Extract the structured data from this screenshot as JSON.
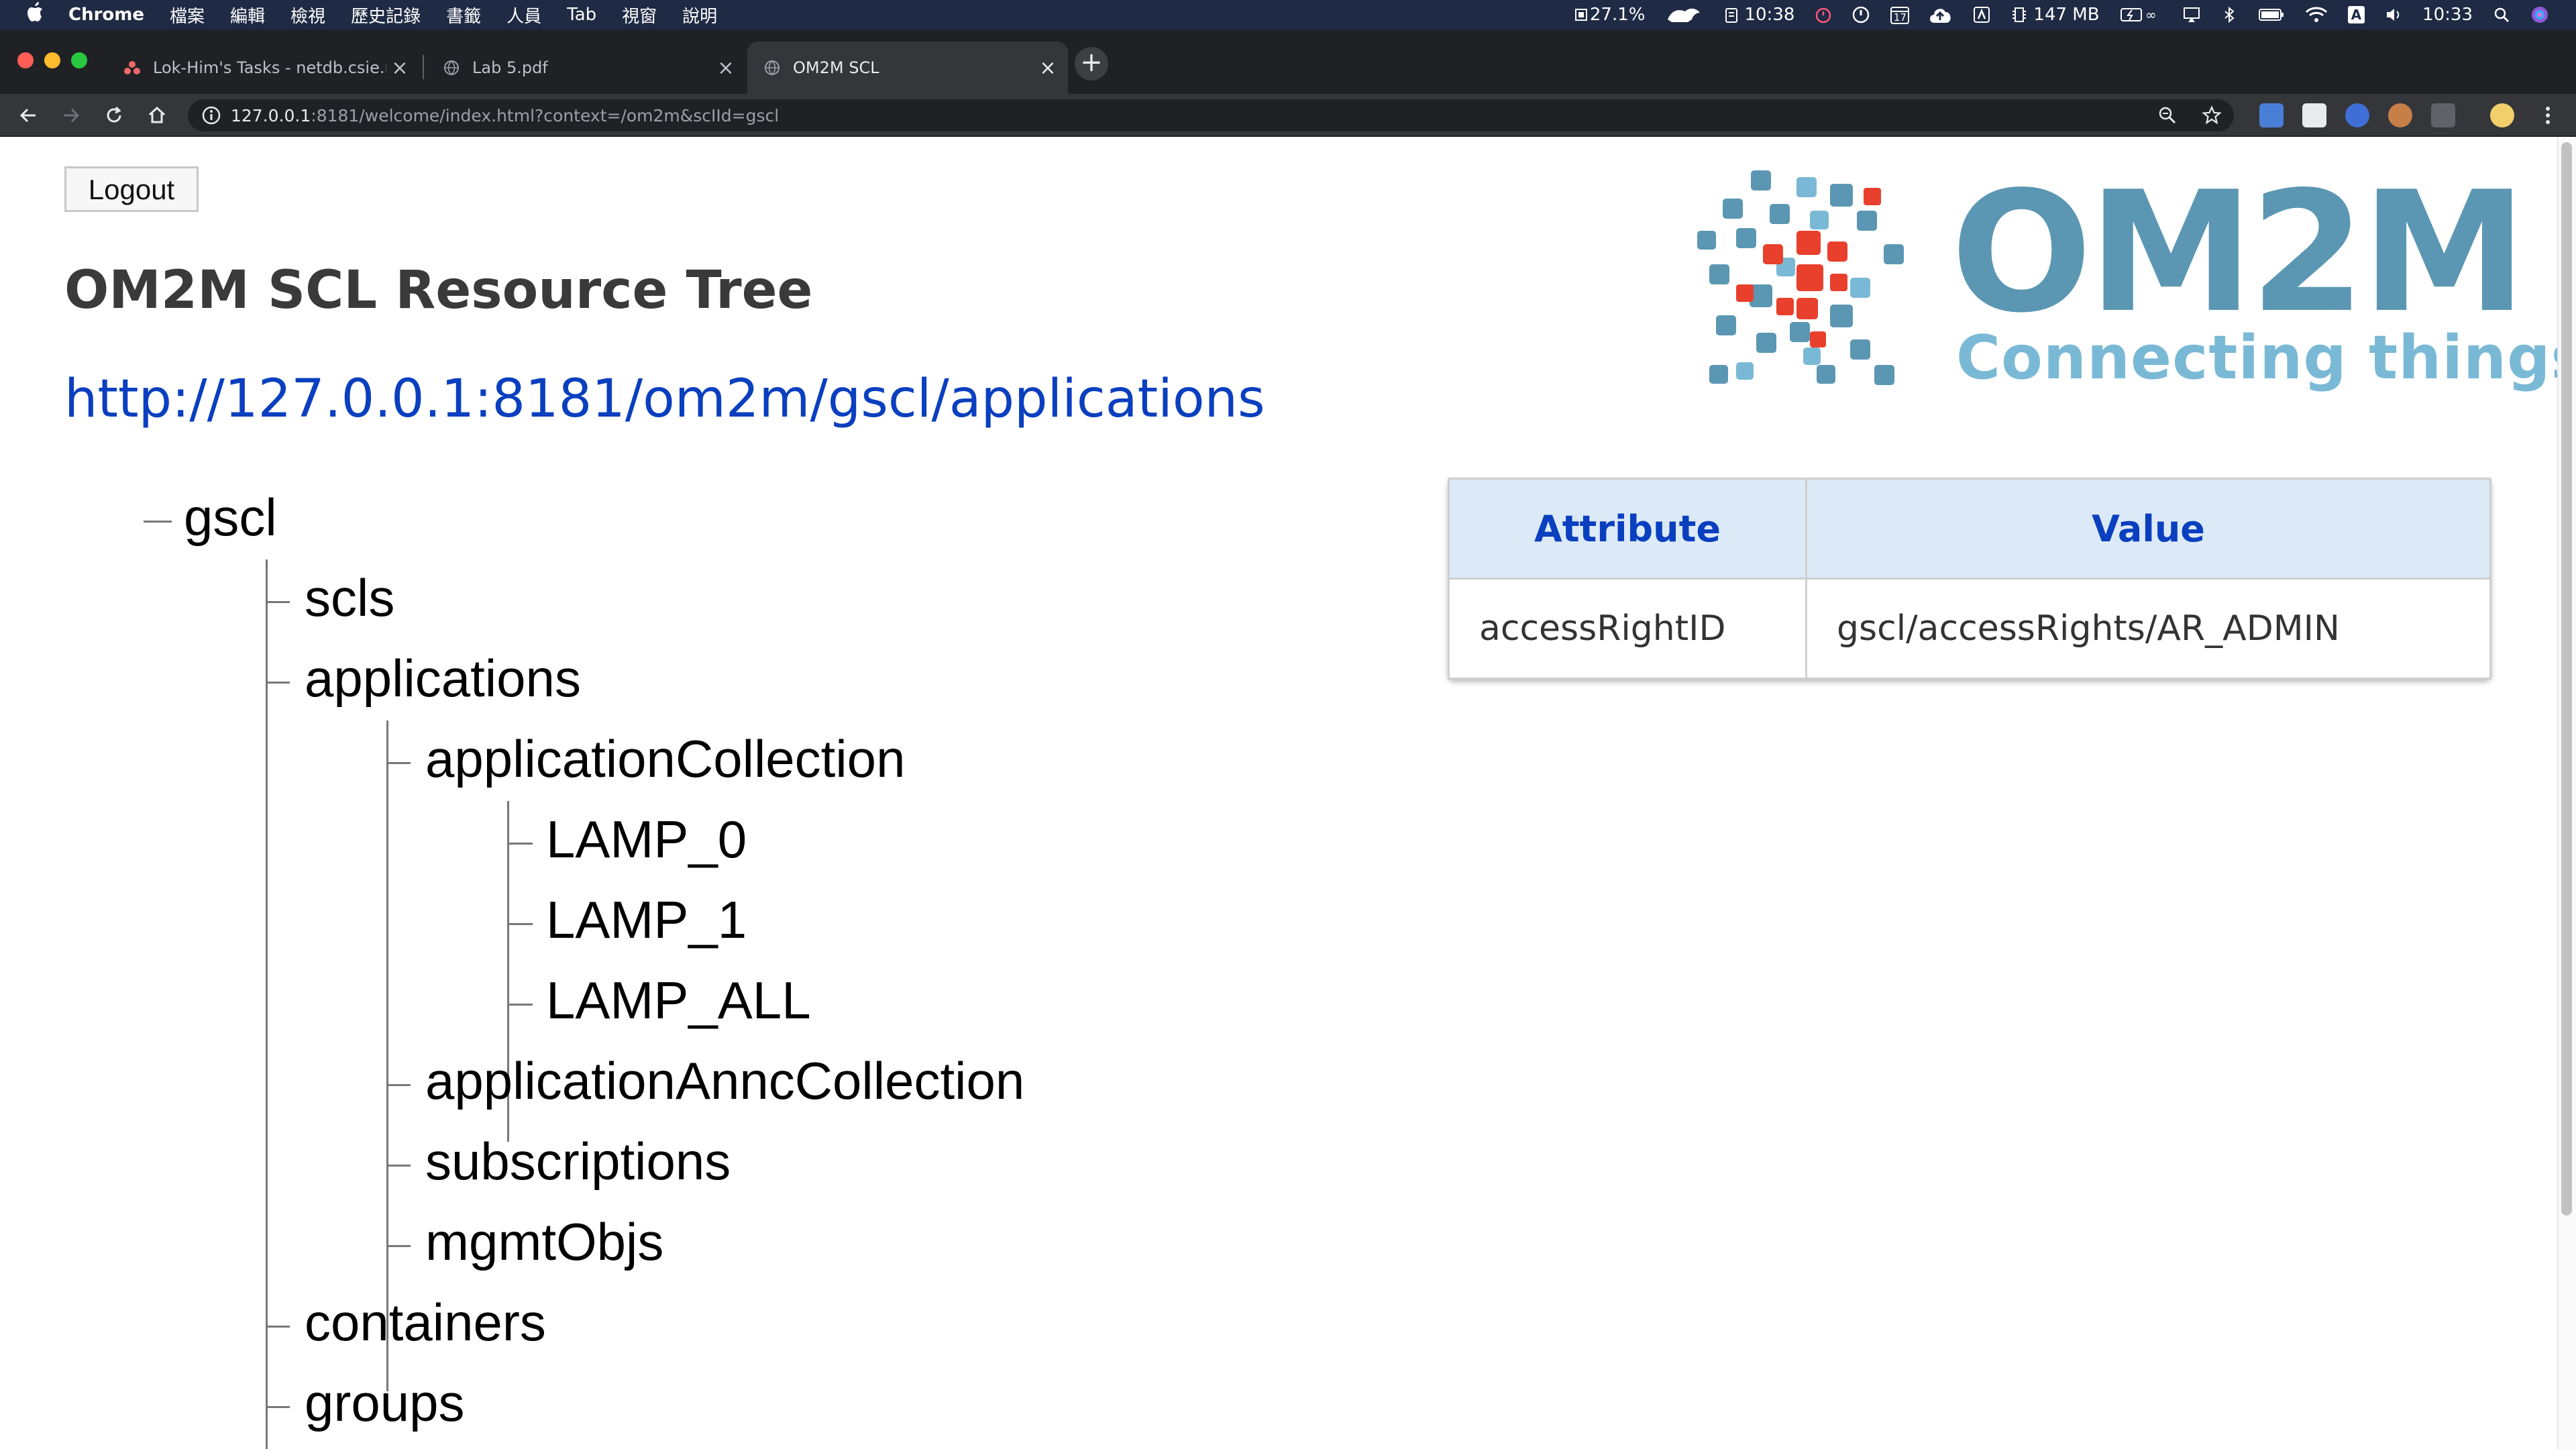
{
  "menubar": {
    "app_name": "Chrome",
    "menus": [
      "檔案",
      "編輯",
      "檢視",
      "歷史記錄",
      "書籤",
      "人員",
      "Tab",
      "視窗",
      "說明"
    ],
    "status": {
      "cpu": "27.1%",
      "time_first": "10:38",
      "calendar_day": "17",
      "memory": "147 MB",
      "input_method": "A",
      "clock": "10:33"
    }
  },
  "browser": {
    "tabs": [
      {
        "title": "Lok-Him's Tasks - netdb.csie.ncku",
        "close": "×"
      },
      {
        "title": "Lab 5.pdf",
        "close": "×"
      },
      {
        "title": "OM2M SCL",
        "close": "×"
      }
    ],
    "new_tab": "+",
    "url_host": "127.0.0.1",
    "url_rest": ":8181/welcome/index.html?context=/om2m&scIId=gscl"
  },
  "page": {
    "logout_label": "Logout",
    "title": "OM2M SCL Resource Tree",
    "resource_uri": "http://127.0.0.1:8181/om2m/gscl/applications",
    "logo": {
      "name": "OM2M",
      "tagline": "Connecting things"
    },
    "tree": {
      "root": "gscl",
      "level1": [
        "scls",
        "applications",
        "containers",
        "groups"
      ],
      "applications_children": [
        "applicationCollection",
        "applicationAnncCollection",
        "subscriptions",
        "mgmtObjs"
      ],
      "applicationCollection_children": [
        "LAMP_0",
        "LAMP_1",
        "LAMP_ALL"
      ]
    },
    "attributes": {
      "header_attribute": "Attribute",
      "header_value": "Value",
      "rows": [
        {
          "attribute": "accessRightID",
          "value": "gscl/accessRights/AR_ADMIN"
        }
      ]
    }
  },
  "colors": {
    "menubar_bg": "#1f2a44",
    "tab_strip_bg": "#202124",
    "active_tab_bg": "#35363a",
    "link_blue": "#0a3fbf",
    "table_header_bg": "#dce9f7",
    "logo_teal": "#5b97b3",
    "logo_red": "#e8402c"
  }
}
